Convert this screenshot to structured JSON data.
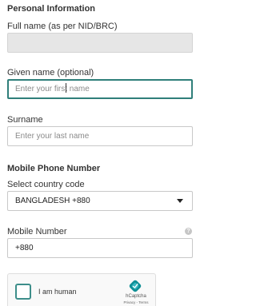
{
  "personal_info": {
    "heading": "Personal Information",
    "full_name_label": "Full name (as per NID/BRC)",
    "full_name_value": "",
    "given_name_label": "Given name (optional)",
    "given_name_placeholder": "Enter your first name",
    "surname_label": "Surname",
    "surname_placeholder": "Enter your last name"
  },
  "mobile": {
    "heading": "Mobile Phone Number",
    "country_label": "Select country code",
    "country_selected": "BANGLADESH +880",
    "number_label": "Mobile Number",
    "number_value": "+880",
    "help_icon_glyph": "?"
  },
  "captcha": {
    "label": "I am human",
    "brand": "hCaptcha",
    "links": "Privacy - Terms",
    "accent_color": "#3d8e8a"
  },
  "colors": {
    "focus_border": "#2f7f7a",
    "disabled_bg": "#e6e6e6"
  }
}
